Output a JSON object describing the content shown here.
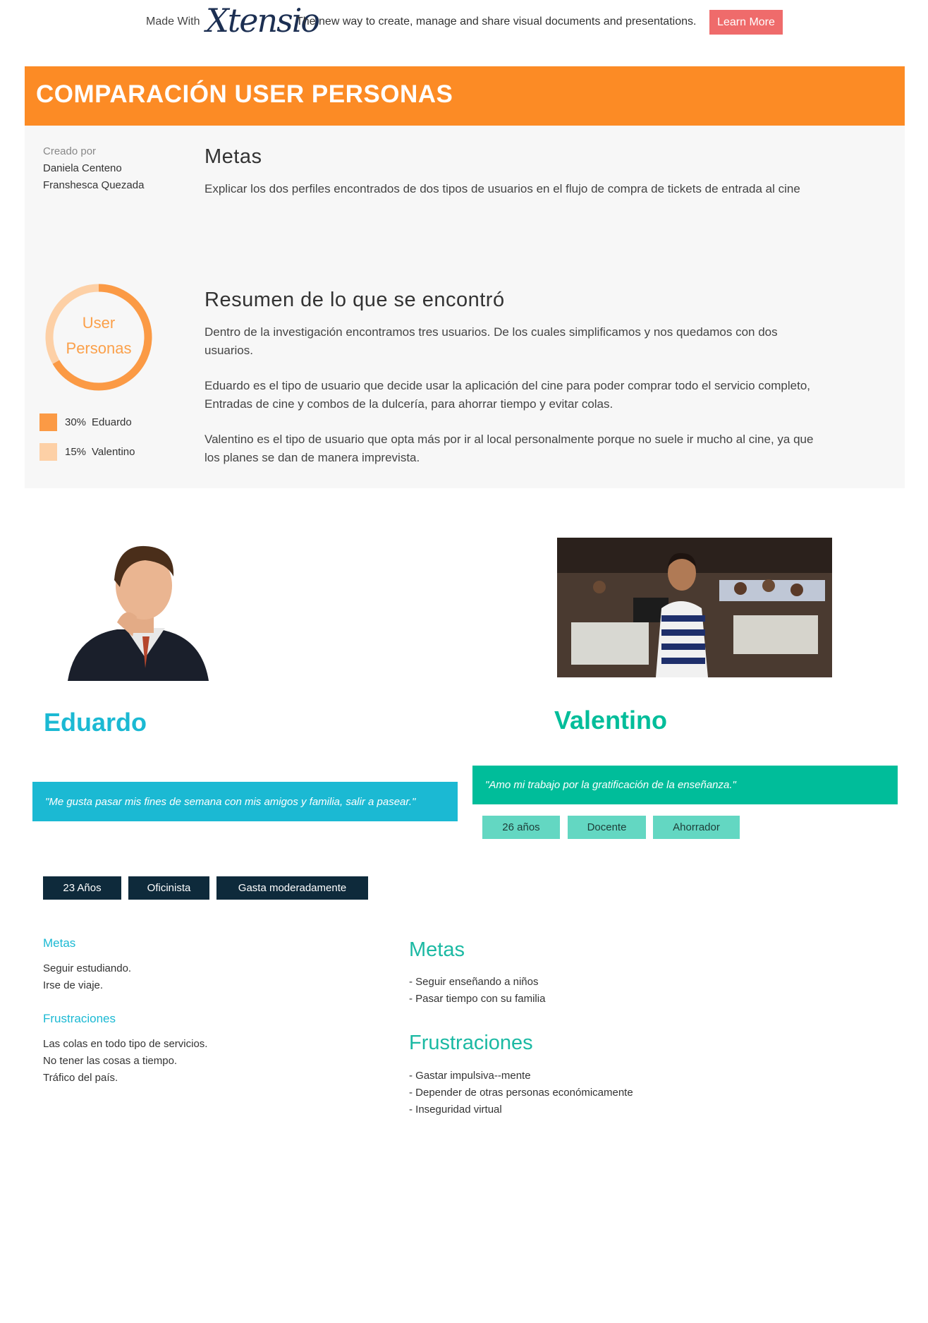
{
  "promo": {
    "made_with": "Made With",
    "logo": "Xtensio",
    "tagline": "The new way to create, manage and share visual documents and presentations.",
    "learn_more": "Learn More"
  },
  "header": {
    "title": "COMPARACIÓN USER PERSONAS"
  },
  "summary": {
    "created_label": "Creado por",
    "authors": [
      "Daniela Centeno",
      "Franshesca Quezada"
    ],
    "goals_title": "Metas",
    "goals_text": "Explicar los dos perfiles encontrados de dos tipos de usuarios en el flujo de compra de tickets de entrada al cine",
    "findings_title": "Resumen de lo que se encontró",
    "findings_paragraphs": [
      "Dentro de la investigación encontramos tres usuarios. De los cuales simplificamos y nos quedamos con dos usuarios.",
      "Eduardo es el tipo de usuario que decide usar la aplicación del cine para poder comprar todo el servicio completo, Entradas de cine y combos de la dulcería, para ahorrar tiempo y evitar colas.",
      "Valentino es el tipo de usuario que opta más por ir al local personalmente porque no suele ir mucho al cine, ya que los planes se dan de manera imprevista."
    ]
  },
  "chart_data": {
    "type": "pie",
    "title": "User Personas",
    "categories": [
      "Eduardo",
      "Valentino"
    ],
    "values": [
      30,
      15
    ],
    "value_labels": [
      "30%",
      "15%"
    ],
    "colors": [
      "#fb9a45",
      "#fdd0a6"
    ]
  },
  "personas": {
    "eduardo": {
      "name": "Eduardo",
      "quote": "\"Me gusta pasar mis fines de semana con mis amigos y familia, salir a pasear.\"",
      "tags": [
        "23 Años",
        "Oficinista",
        "Gasta moderadamente"
      ],
      "goals_title": "Metas",
      "goals": [
        "Seguir estudiando.",
        "Irse de viaje."
      ],
      "frustrations_title": "Frustraciones",
      "frustrations": [
        "Las colas en todo tipo de servicios.",
        "No tener las cosas a tiempo.",
        "Tráfico del país."
      ]
    },
    "valentino": {
      "name": "Valentino",
      "quote": "\"Amo mi trabajo por la gratificación de la enseñanza.\"",
      "tags": [
        "26 años",
        "Docente",
        "Ahorrador"
      ],
      "goals_title": "Metas",
      "goals": [
        "- Seguir enseñando a niños",
        "- Pasar tiempo con su familia"
      ],
      "frustrations_title": "Frustraciones",
      "frustrations": [
        "- Gastar impulsiva--mente",
        "- Depender de otras personas económicamente",
        "- Inseguridad virtual"
      ]
    }
  },
  "colors": {
    "orange": "#fc8b25",
    "eduardo_accent": "#1bb9d3",
    "valentino_accent": "#00bd9a",
    "dark_tag": "#0e2a3b",
    "light_teal_tag": "#63d7c2",
    "promo_button": "#ef6b6b"
  }
}
